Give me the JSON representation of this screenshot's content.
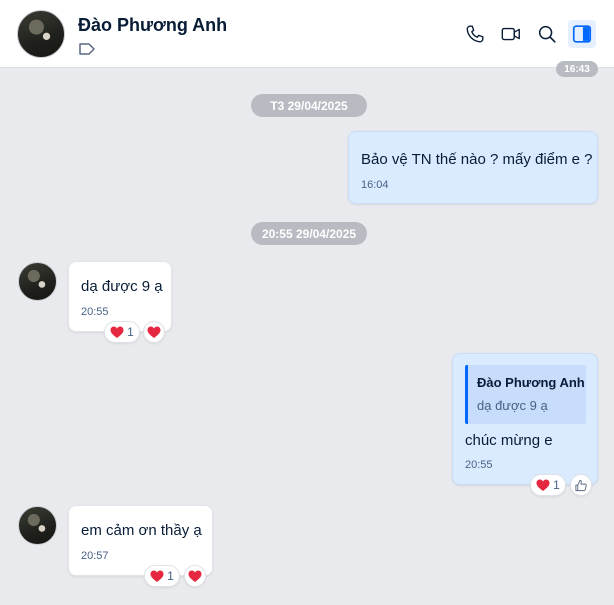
{
  "header": {
    "contact_name": "Đào Phương Anh"
  },
  "chat": {
    "partial_time": "16:43",
    "date_separators": [
      "T3 29/04/2025",
      "20:55 29/04/2025"
    ],
    "messages": [
      {
        "text": "Bảo vệ TN thế nào ? mấy điểm e ?",
        "time": "16:04"
      },
      {
        "text": "dạ được 9 ạ",
        "time": "20:55",
        "reaction_count": "1"
      },
      {
        "quote_name": "Đào Phương Anh",
        "quote_text": "dạ được 9 ạ",
        "text": "chúc mừng e",
        "time": "20:55",
        "reaction_count": "1"
      },
      {
        "text": "em cảm ơn thầy ạ",
        "time": "20:57",
        "reaction_count": "1"
      }
    ]
  },
  "colors": {
    "accent": "#0068ff",
    "heart": "#e5283f",
    "my_bubble": "#dbebff",
    "chat_bg": "#e9eaee"
  },
  "icons": [
    "phone-icon",
    "video-call-icon",
    "search-icon",
    "sidebar-toggle-icon",
    "tag-icon",
    "heart-icon",
    "thumbs-up-icon"
  ]
}
